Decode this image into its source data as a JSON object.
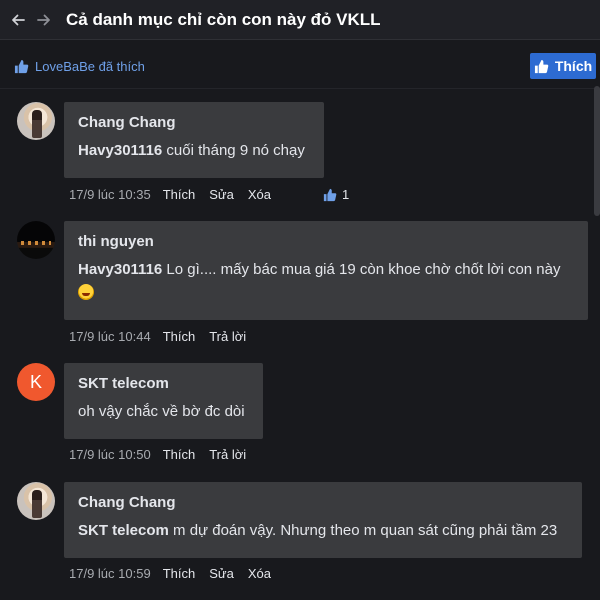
{
  "header": {
    "title": "Cả danh mục chỉ còn con này đỏ VKLL"
  },
  "likebar": {
    "liked_by": "LoveBaBe đã thích",
    "like_button": "Thích"
  },
  "comments": [
    {
      "author": "Chang Chang",
      "mention": "Havy301116",
      "text": " cuối tháng 9 nó chạy",
      "time": "17/9 lúc 10:35",
      "actions": [
        "Thích",
        "Sửa",
        "Xóa"
      ],
      "likes": "1"
    },
    {
      "author": "thi nguyen",
      "mention": "Havy301116",
      "text": " Lo gì.... mấy bác mua giá 19 còn khoe chờ chốt lời con này",
      "time": "17/9 lúc 10:44",
      "actions": [
        "Thích",
        "Trả lời"
      ]
    },
    {
      "author": "SKT telecom",
      "avatar_letter": "K",
      "text": "oh vậy chắc về bờ đc dòi",
      "time": "17/9 lúc 10:50",
      "actions": [
        "Thích",
        "Trả lời"
      ]
    },
    {
      "author": "Chang Chang",
      "mention": "SKT telecom",
      "text": " m dự đoán vậy. Nhưng theo m quan sát cũng phải tầm 23",
      "time": "17/9 lúc 10:59",
      "actions": [
        "Thích",
        "Sửa",
        "Xóa"
      ]
    }
  ],
  "colors": {
    "background": "#18191d",
    "bubble": "#3a3b3e",
    "accent": "#2d6bd2",
    "avatar_letter_bg": "#f0582e"
  },
  "icons": [
    "back-arrow-icon",
    "forward-arrow-icon",
    "thumbs-up-icon",
    "laughing-emoji-icon"
  ]
}
